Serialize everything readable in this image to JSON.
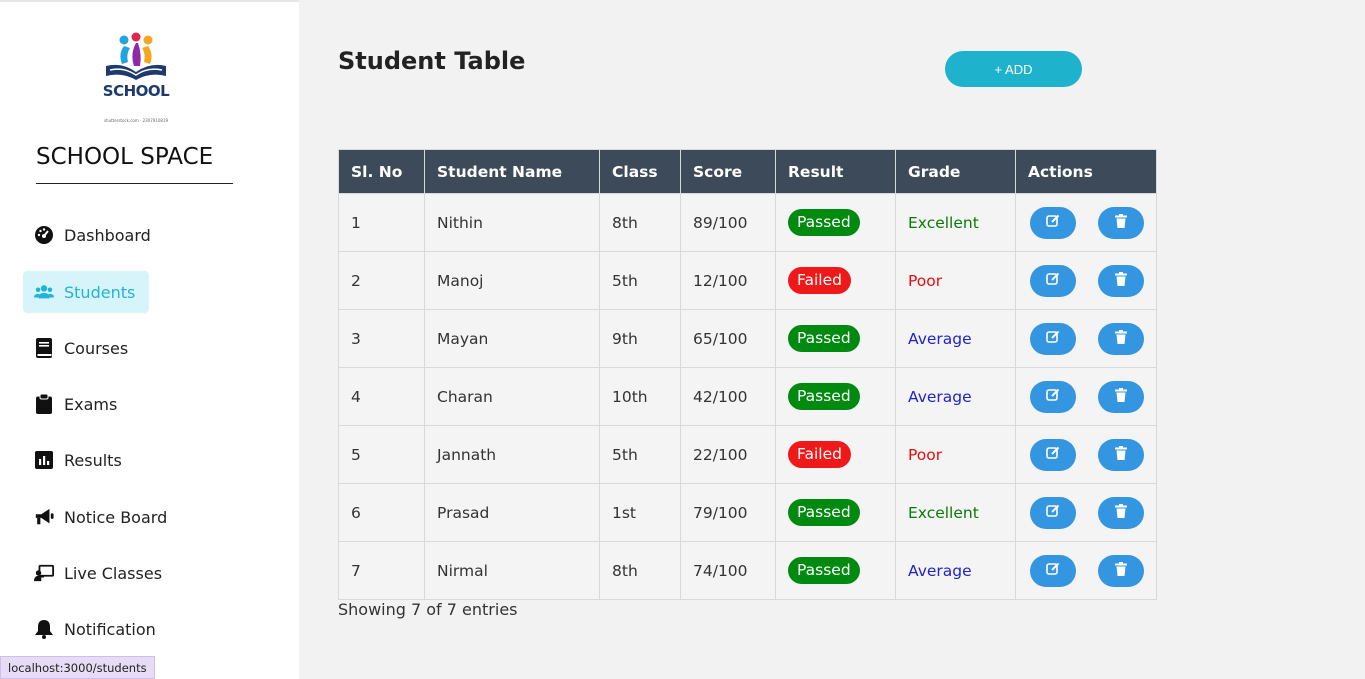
{
  "sidebar": {
    "logo_text": "SCHOOL",
    "logo_fineprint": "shutterstock.com · 2307910819",
    "brand": "SCHOOL SPACE",
    "items": [
      {
        "label": "Dashboard",
        "icon": "dashboard-gauge-icon",
        "active": false
      },
      {
        "label": "Students",
        "icon": "users-icon",
        "active": true
      },
      {
        "label": "Courses",
        "icon": "book-icon",
        "active": false
      },
      {
        "label": "Exams",
        "icon": "clipboard-icon",
        "active": false
      },
      {
        "label": "Results",
        "icon": "chart-icon",
        "active": false
      },
      {
        "label": "Notice Board",
        "icon": "megaphone-icon",
        "active": false
      },
      {
        "label": "Live Classes",
        "icon": "chalkboard-teacher-icon",
        "active": false
      },
      {
        "label": "Notification",
        "icon": "bell-icon",
        "active": false
      }
    ]
  },
  "main": {
    "title": "Student Table",
    "add_label": "+ ADD",
    "columns": [
      "Sl. No",
      "Student Name",
      "Class",
      "Score",
      "Result",
      "Grade",
      "Actions"
    ],
    "rows": [
      {
        "no": "1",
        "name": "Nithin",
        "class": "8th",
        "score": "89/100",
        "result": "Passed",
        "grade": "Excellent"
      },
      {
        "no": "2",
        "name": "Manoj",
        "class": "5th",
        "score": "12/100",
        "result": "Failed",
        "grade": "Poor"
      },
      {
        "no": "3",
        "name": "Mayan",
        "class": "9th",
        "score": "65/100",
        "result": "Passed",
        "grade": "Average"
      },
      {
        "no": "4",
        "name": "Charan",
        "class": "10th",
        "score": "42/100",
        "result": "Passed",
        "grade": "Average"
      },
      {
        "no": "5",
        "name": "Jannath",
        "class": "5th",
        "score": "22/100",
        "result": "Failed",
        "grade": "Poor"
      },
      {
        "no": "6",
        "name": "Prasad",
        "class": "1st",
        "score": "79/100",
        "result": "Passed",
        "grade": "Excellent"
      },
      {
        "no": "7",
        "name": "Nirmal",
        "class": "8th",
        "score": "74/100",
        "result": "Passed",
        "grade": "Average"
      }
    ],
    "entries_info": "Showing 7 of 7 entries"
  },
  "status_bar": {
    "url": "localhost:3000/students"
  },
  "colors": {
    "accent": "#1fb2cc",
    "header_bg": "#3d4a59",
    "passed": "#008a0f",
    "failed": "#f01919",
    "action_button": "#3496e0",
    "active_nav_bg": "#d8f4fb"
  }
}
